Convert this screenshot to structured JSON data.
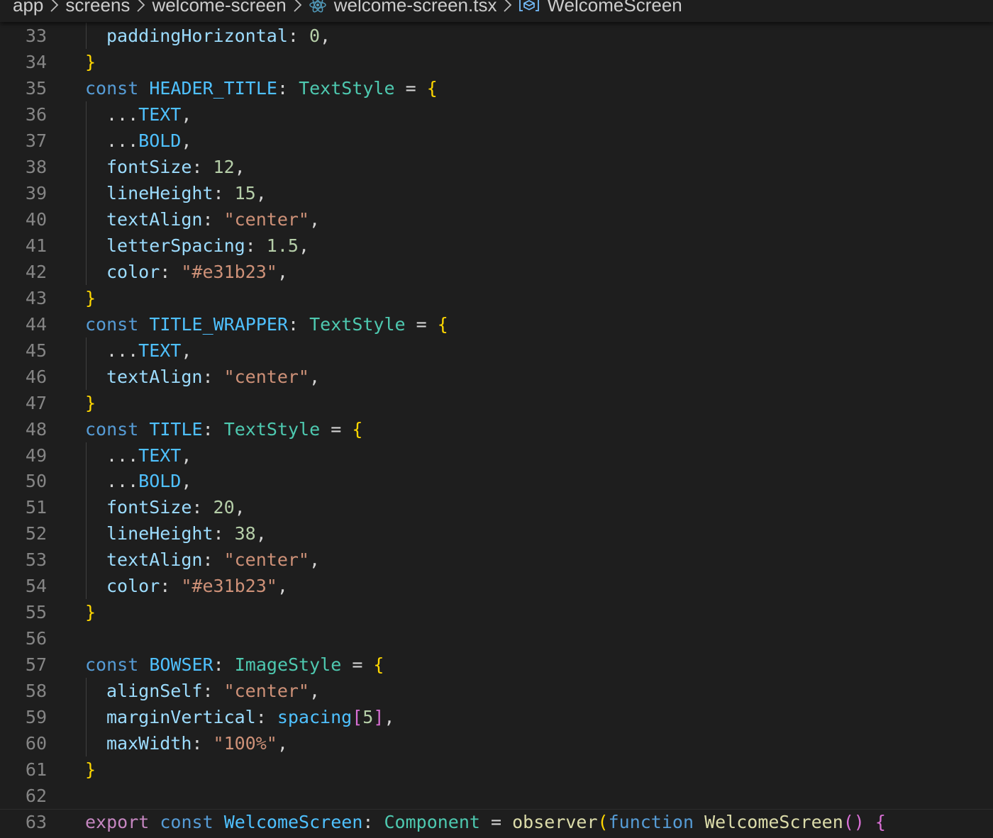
{
  "breadcrumb": {
    "items": [
      "app",
      "screens",
      "welcome-screen",
      "welcome-screen.tsx",
      "WelcomeScreen"
    ],
    "icons": [
      "react-icon",
      "symbol-variable-icon"
    ]
  },
  "editor": {
    "current_line": 63,
    "lines": [
      {
        "n": "33",
        "indent": 1,
        "tokens": [
          [
            "prop",
            "paddingHorizontal"
          ],
          [
            "punc",
            ": "
          ],
          [
            "num",
            "0"
          ],
          [
            "punc",
            ","
          ]
        ]
      },
      {
        "n": "34",
        "indent": 0,
        "tokens": [
          [
            "br1",
            "}"
          ]
        ]
      },
      {
        "n": "35",
        "indent": 0,
        "tokens": [
          [
            "kw",
            "const"
          ],
          [
            "punc",
            " "
          ],
          [
            "const",
            "HEADER_TITLE"
          ],
          [
            "punc",
            ": "
          ],
          [
            "type",
            "TextStyle"
          ],
          [
            "punc",
            " = "
          ],
          [
            "br1",
            "{"
          ]
        ]
      },
      {
        "n": "36",
        "indent": 1,
        "tokens": [
          [
            "punc",
            "..."
          ],
          [
            "const",
            "TEXT"
          ],
          [
            "punc",
            ","
          ]
        ]
      },
      {
        "n": "37",
        "indent": 1,
        "tokens": [
          [
            "punc",
            "..."
          ],
          [
            "const",
            "BOLD"
          ],
          [
            "punc",
            ","
          ]
        ]
      },
      {
        "n": "38",
        "indent": 1,
        "tokens": [
          [
            "prop",
            "fontSize"
          ],
          [
            "punc",
            ": "
          ],
          [
            "num",
            "12"
          ],
          [
            "punc",
            ","
          ]
        ]
      },
      {
        "n": "39",
        "indent": 1,
        "tokens": [
          [
            "prop",
            "lineHeight"
          ],
          [
            "punc",
            ": "
          ],
          [
            "num",
            "15"
          ],
          [
            "punc",
            ","
          ]
        ]
      },
      {
        "n": "40",
        "indent": 1,
        "tokens": [
          [
            "prop",
            "textAlign"
          ],
          [
            "punc",
            ": "
          ],
          [
            "str",
            "\"center\""
          ],
          [
            "punc",
            ","
          ]
        ]
      },
      {
        "n": "41",
        "indent": 1,
        "tokens": [
          [
            "prop",
            "letterSpacing"
          ],
          [
            "punc",
            ": "
          ],
          [
            "num",
            "1.5"
          ],
          [
            "punc",
            ","
          ]
        ]
      },
      {
        "n": "42",
        "indent": 1,
        "tokens": [
          [
            "prop",
            "color"
          ],
          [
            "punc",
            ": "
          ],
          [
            "str",
            "\"#e31b23\""
          ],
          [
            "punc",
            ","
          ]
        ]
      },
      {
        "n": "43",
        "indent": 0,
        "tokens": [
          [
            "br1",
            "}"
          ]
        ]
      },
      {
        "n": "44",
        "indent": 0,
        "tokens": [
          [
            "kw",
            "const"
          ],
          [
            "punc",
            " "
          ],
          [
            "const",
            "TITLE_WRAPPER"
          ],
          [
            "punc",
            ": "
          ],
          [
            "type",
            "TextStyle"
          ],
          [
            "punc",
            " = "
          ],
          [
            "br1",
            "{"
          ]
        ]
      },
      {
        "n": "45",
        "indent": 1,
        "tokens": [
          [
            "punc",
            "..."
          ],
          [
            "const",
            "TEXT"
          ],
          [
            "punc",
            ","
          ]
        ]
      },
      {
        "n": "46",
        "indent": 1,
        "tokens": [
          [
            "prop",
            "textAlign"
          ],
          [
            "punc",
            ": "
          ],
          [
            "str",
            "\"center\""
          ],
          [
            "punc",
            ","
          ]
        ]
      },
      {
        "n": "47",
        "indent": 0,
        "tokens": [
          [
            "br1",
            "}"
          ]
        ]
      },
      {
        "n": "48",
        "indent": 0,
        "tokens": [
          [
            "kw",
            "const"
          ],
          [
            "punc",
            " "
          ],
          [
            "const",
            "TITLE"
          ],
          [
            "punc",
            ": "
          ],
          [
            "type",
            "TextStyle"
          ],
          [
            "punc",
            " = "
          ],
          [
            "br1",
            "{"
          ]
        ]
      },
      {
        "n": "49",
        "indent": 1,
        "tokens": [
          [
            "punc",
            "..."
          ],
          [
            "const",
            "TEXT"
          ],
          [
            "punc",
            ","
          ]
        ]
      },
      {
        "n": "50",
        "indent": 1,
        "tokens": [
          [
            "punc",
            "..."
          ],
          [
            "const",
            "BOLD"
          ],
          [
            "punc",
            ","
          ]
        ]
      },
      {
        "n": "51",
        "indent": 1,
        "tokens": [
          [
            "prop",
            "fontSize"
          ],
          [
            "punc",
            ": "
          ],
          [
            "num",
            "20"
          ],
          [
            "punc",
            ","
          ]
        ]
      },
      {
        "n": "52",
        "indent": 1,
        "tokens": [
          [
            "prop",
            "lineHeight"
          ],
          [
            "punc",
            ": "
          ],
          [
            "num",
            "38"
          ],
          [
            "punc",
            ","
          ]
        ]
      },
      {
        "n": "53",
        "indent": 1,
        "tokens": [
          [
            "prop",
            "textAlign"
          ],
          [
            "punc",
            ": "
          ],
          [
            "str",
            "\"center\""
          ],
          [
            "punc",
            ","
          ]
        ]
      },
      {
        "n": "54",
        "indent": 1,
        "tokens": [
          [
            "prop",
            "color"
          ],
          [
            "punc",
            ": "
          ],
          [
            "str",
            "\"#e31b23\""
          ],
          [
            "punc",
            ","
          ]
        ]
      },
      {
        "n": "55",
        "indent": 0,
        "tokens": [
          [
            "br1",
            "}"
          ]
        ]
      },
      {
        "n": "56",
        "indent": 0,
        "tokens": []
      },
      {
        "n": "57",
        "indent": 0,
        "tokens": [
          [
            "kw",
            "const"
          ],
          [
            "punc",
            " "
          ],
          [
            "const",
            "BOWSER"
          ],
          [
            "punc",
            ": "
          ],
          [
            "type",
            "ImageStyle"
          ],
          [
            "punc",
            " = "
          ],
          [
            "br1",
            "{"
          ]
        ]
      },
      {
        "n": "58",
        "indent": 1,
        "tokens": [
          [
            "prop",
            "alignSelf"
          ],
          [
            "punc",
            ": "
          ],
          [
            "str",
            "\"center\""
          ],
          [
            "punc",
            ","
          ]
        ]
      },
      {
        "n": "59",
        "indent": 1,
        "tokens": [
          [
            "prop",
            "marginVertical"
          ],
          [
            "punc",
            ": "
          ],
          [
            "const",
            "spacing"
          ],
          [
            "br2",
            "["
          ],
          [
            "num",
            "5"
          ],
          [
            "br2",
            "]"
          ],
          [
            "punc",
            ","
          ]
        ]
      },
      {
        "n": "60",
        "indent": 1,
        "tokens": [
          [
            "prop",
            "maxWidth"
          ],
          [
            "punc",
            ": "
          ],
          [
            "str",
            "\"100%\""
          ],
          [
            "punc",
            ","
          ]
        ]
      },
      {
        "n": "61",
        "indent": 0,
        "tokens": [
          [
            "br1",
            "}"
          ]
        ]
      },
      {
        "n": "62",
        "indent": 0,
        "tokens": []
      },
      {
        "n": "63",
        "indent": 0,
        "tokens": [
          [
            "export",
            "export"
          ],
          [
            "punc",
            " "
          ],
          [
            "kw",
            "const"
          ],
          [
            "punc",
            " "
          ],
          [
            "const",
            "WelcomeScreen"
          ],
          [
            "punc",
            ": "
          ],
          [
            "type",
            "Component"
          ],
          [
            "punc",
            " = "
          ],
          [
            "fn",
            "observer"
          ],
          [
            "br1",
            "("
          ],
          [
            "kw",
            "function"
          ],
          [
            "punc",
            " "
          ],
          [
            "fn",
            "WelcomeScreen"
          ],
          [
            "br2",
            "()"
          ],
          [
            "punc",
            " "
          ],
          [
            "br2",
            "{"
          ]
        ]
      }
    ]
  }
}
